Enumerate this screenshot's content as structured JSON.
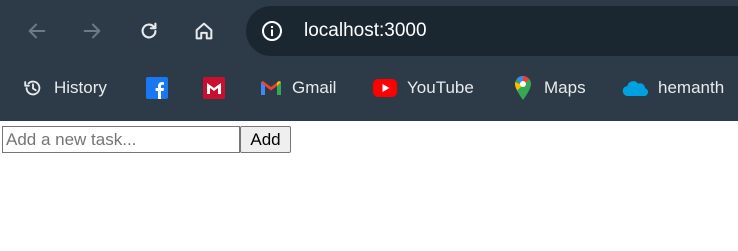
{
  "browser": {
    "url": "localhost:3000",
    "bookmarks": [
      {
        "label": "History",
        "icon": "history-icon"
      },
      {
        "label": "",
        "icon": "facebook-icon"
      },
      {
        "label": "",
        "icon": "mcafee-icon"
      },
      {
        "label": "Gmail",
        "icon": "gmail-icon"
      },
      {
        "label": "YouTube",
        "icon": "youtube-icon"
      },
      {
        "label": "Maps",
        "icon": "maps-icon"
      },
      {
        "label": "hemanth",
        "icon": "cloud-icon"
      }
    ],
    "colors": {
      "chrome_bg": "#2c3b47",
      "omnibox_bg": "#1b2730",
      "facebook": "#1877f2",
      "mcafee": "#c8102e",
      "youtube": "#ff0000",
      "cloud": "#00a1e0"
    }
  },
  "app": {
    "task_input": {
      "placeholder": "Add a new task...",
      "value": ""
    },
    "add_button_label": "Add"
  }
}
